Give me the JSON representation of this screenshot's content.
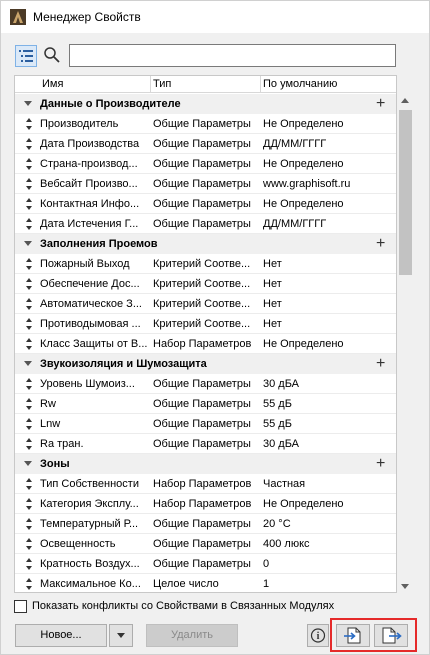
{
  "window": {
    "title": "Менеджер Свойств"
  },
  "search": {
    "value": ""
  },
  "columns": {
    "name": "Имя",
    "type": "Тип",
    "default": "По умолчанию"
  },
  "groups": [
    {
      "name": "Данные о Производителе",
      "rows": [
        {
          "name": "Производитель",
          "type": "Общие Параметры",
          "default": "Не Определено"
        },
        {
          "name": "Дата Производства",
          "type": "Общие Параметры",
          "default": "ДД/ММ/ГГГГ"
        },
        {
          "name": "Страна-производ...",
          "type": "Общие Параметры",
          "default": "Не Определено"
        },
        {
          "name": "Вебсайт Произво...",
          "type": "Общие Параметры",
          "default": "www.graphisoft.ru"
        },
        {
          "name": "Контактная Инфо...",
          "type": "Общие Параметры",
          "default": "Не Определено"
        },
        {
          "name": "Дата Истечения Г...",
          "type": "Общие Параметры",
          "default": "ДД/ММ/ГГГГ"
        }
      ]
    },
    {
      "name": "Заполнения Проемов",
      "rows": [
        {
          "name": "Пожарный Выход",
          "type": "Критерий Соотве...",
          "default": "Нет"
        },
        {
          "name": "Обеспечение Дос...",
          "type": "Критерий Соотве...",
          "default": "Нет"
        },
        {
          "name": "Автоматическое З...",
          "type": "Критерий Соотве...",
          "default": "Нет"
        },
        {
          "name": "Противодымовая ...",
          "type": "Критерий Соотве...",
          "default": "Нет"
        },
        {
          "name": "Класс Защиты от В...",
          "type": "Набор Параметров",
          "default": "Не Определено"
        }
      ]
    },
    {
      "name": "Звукоизоляция и Шумозащита",
      "rows": [
        {
          "name": "Уровень Шумоиз...",
          "type": "Общие Параметры",
          "default": "30 дБА"
        },
        {
          "name": "Rw",
          "type": "Общие Параметры",
          "default": "55 дБ"
        },
        {
          "name": "Lnw",
          "type": "Общие Параметры",
          "default": "55 дБ"
        },
        {
          "name": "Ra тран.",
          "type": "Общие Параметры",
          "default": "30 дБА"
        }
      ]
    },
    {
      "name": "Зоны",
      "rows": [
        {
          "name": "Тип Собственности",
          "type": "Набор Параметров",
          "default": "Частная"
        },
        {
          "name": "Категория Эксплу...",
          "type": "Набор Параметров",
          "default": "Не Определено"
        },
        {
          "name": "Температурный Р...",
          "type": "Общие Параметры",
          "default": "20 °C"
        },
        {
          "name": "Освещенность",
          "type": "Общие Параметры",
          "default": "400 люкс"
        },
        {
          "name": "Кратность Воздух...",
          "type": "Общие Параметры",
          "default": "0"
        },
        {
          "name": "Максимальное Ко...",
          "type": "Целое число",
          "default": "1"
        }
      ]
    }
  ],
  "footer": {
    "conflict_label": "Показать конфликты со Свойствами в Связанных Модулях",
    "new_label": "Новое...",
    "delete_label": "Удалить",
    "info_label": "i"
  },
  "colors": {
    "highlight": "#e52a2a",
    "selected_tool": "#dbe9f8"
  }
}
